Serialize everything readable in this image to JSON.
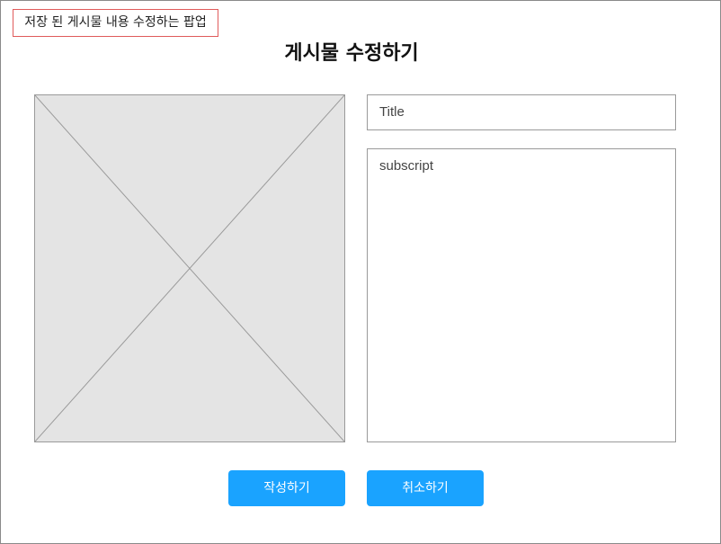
{
  "annotation": {
    "note": "저장 된 게시물 내용 수정하는 팝업"
  },
  "popup": {
    "title": "게시물 수정하기",
    "image_placeholder_icon": "image-placeholder-icon",
    "title_input": {
      "placeholder": "Title"
    },
    "body_input": {
      "placeholder": "subscript"
    },
    "buttons": {
      "submit_label": "작성하기",
      "cancel_label": "취소하기"
    },
    "colors": {
      "button": "#1aa3ff",
      "annotation_border": "#e05b5b",
      "placeholder_fill": "#e4e4e4"
    }
  }
}
